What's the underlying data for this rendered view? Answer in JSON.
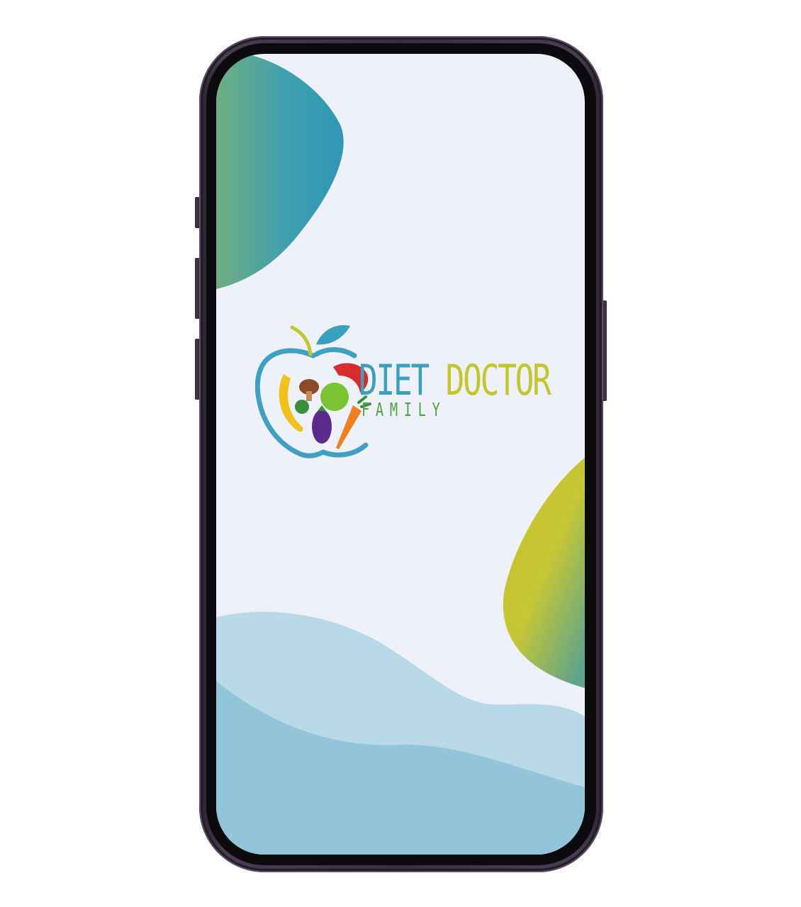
{
  "app": {
    "logo": {
      "line1_word1": "DIET",
      "line1_word2": "DOCTOR",
      "line2": "FAMILY"
    }
  },
  "colors": {
    "screen_background": "#eef1f9",
    "blob_teal": "#2f97b6",
    "blob_green": "#72b27a",
    "blob_yellow": "#c9c52d",
    "wave_light": "#b9d9e8",
    "wave_dark": "#92c5d9",
    "brand_blue": "#3aa0c0",
    "brand_yellow": "#c5c62c",
    "brand_green": "#4aa53a",
    "phone_frame": "#3a2f40"
  }
}
